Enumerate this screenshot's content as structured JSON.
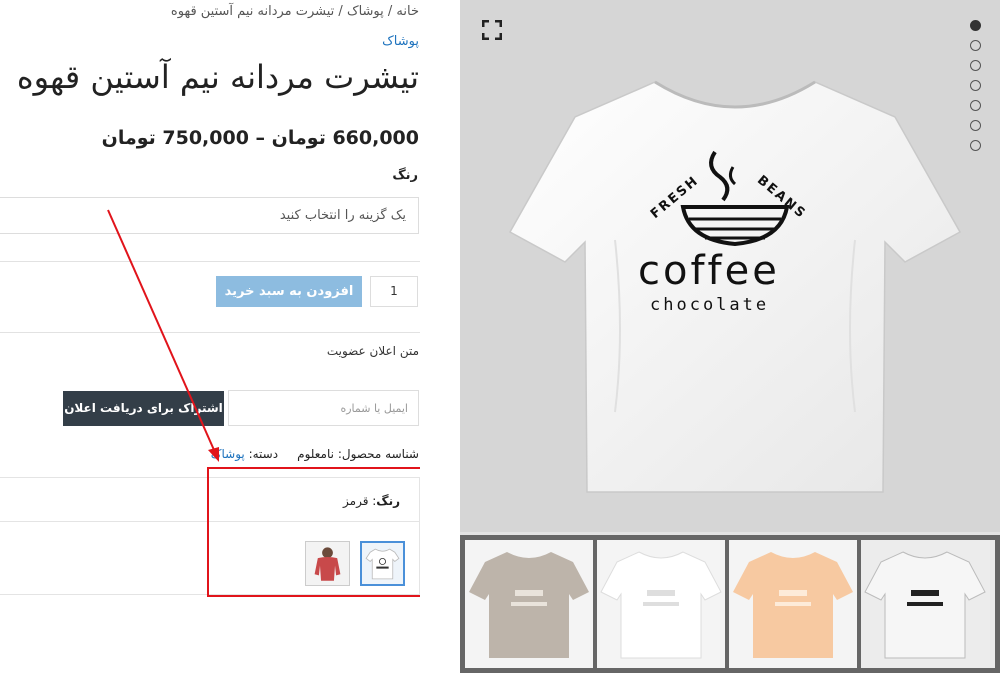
{
  "breadcrumb": "خانه / پوشاک / تیشرت مردانه نیم آستین قهوه",
  "category_link": "پوشاک",
  "product": {
    "title": "تیشرت مردانه نیم آستین قهوه",
    "price_range": "660,000 تومان – 750,000 تومان"
  },
  "variation": {
    "label": "رنگ",
    "select_placeholder": "یک گزینه را انتخاب کنید"
  },
  "cart": {
    "quantity": "1",
    "add_button": "افزودن به سبد خرید"
  },
  "notify": {
    "text": "متن اعلان عضویت",
    "input_placeholder": "ایمیل یا شماره",
    "subscribe_button": "اشتراک برای دریافت اعلان"
  },
  "meta": {
    "sku_label": "شناسه محصول:",
    "sku_value": "نامعلوم",
    "category_label": "دسته:",
    "category_value": "پوشاک"
  },
  "selected_variation": {
    "attr_label": "رنگ",
    "attr_value": "قرمز"
  },
  "shirt_print": {
    "arc_left": "FRESH",
    "arc_right": "BEANS",
    "main": "coffee",
    "sub": "chocolate"
  },
  "thumbnails": [
    {
      "name": "grey",
      "color": "#bdb4aa"
    },
    {
      "name": "white",
      "color": "#ffffff"
    },
    {
      "name": "peach",
      "color": "#f7c9a1"
    },
    {
      "name": "white-dark-print",
      "color": "#f6f6f6"
    }
  ],
  "colors": {
    "link": "#1e73be",
    "add_button": "#8dbce0",
    "subscribe_button": "#333e48",
    "annotation": "#e1141b"
  }
}
